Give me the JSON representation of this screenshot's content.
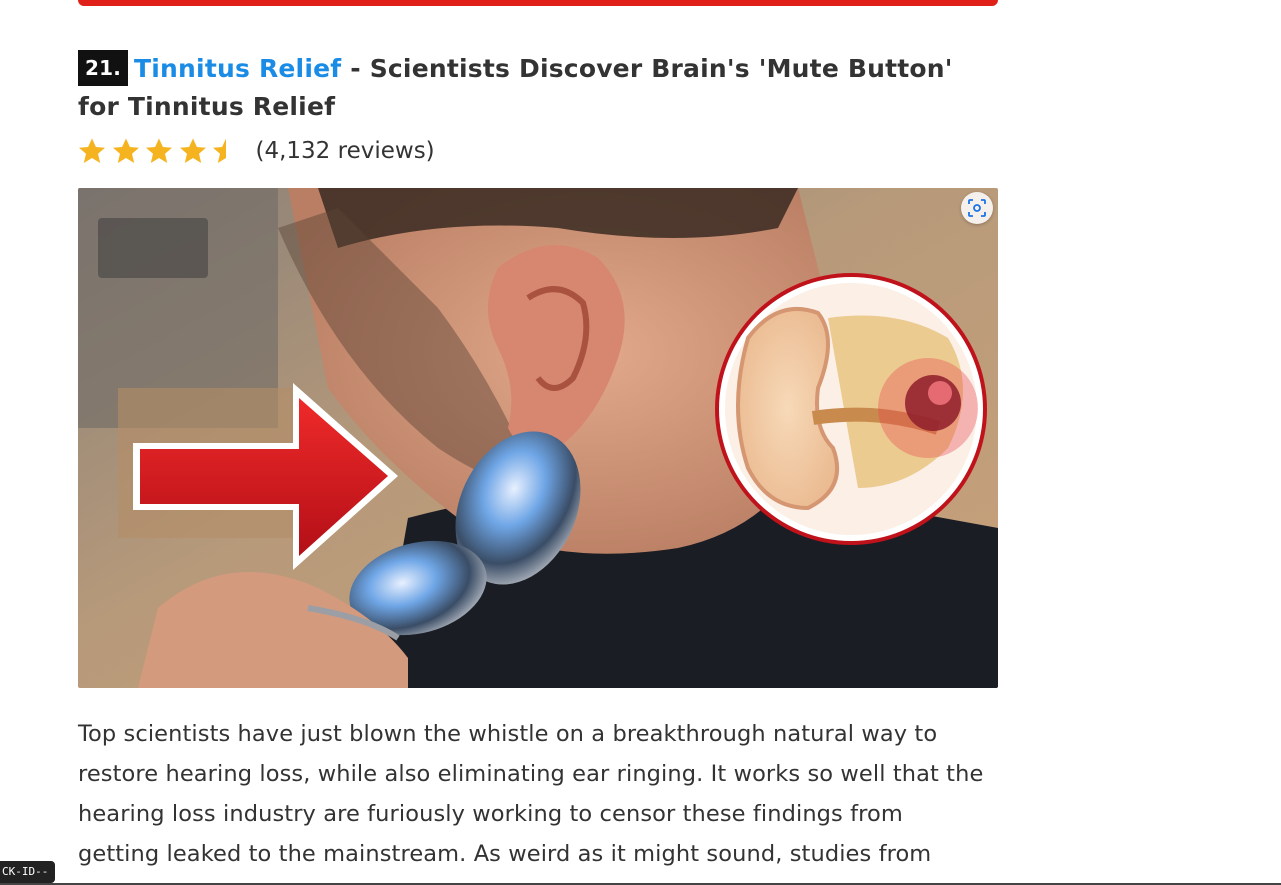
{
  "headline": {
    "number": "21.",
    "link_text": "Tinnitus Relief",
    "rest": " - Scientists Discover Brain's 'Mute Button' for Tinnitus Relief"
  },
  "rating": {
    "value": 4.5,
    "max": 5,
    "reviews_text": "(4,132 reviews)",
    "star_color": "#f5b41f"
  },
  "hero_image": {
    "lens_icon": "visual-search-icon"
  },
  "body": {
    "paragraph": "Top scientists have just blown the whistle on a breakthrough natural way to restore hearing loss, while also eliminating ear ringing. It works so well that the hearing loss industry are furiously working to censor these findings from getting leaked to the mainstream. As weird as it might sound, studies from"
  },
  "debug_tag": "CK-ID--",
  "colors": {
    "accent_red": "#e0211a",
    "link_blue": "#1a8ce6",
    "text": "#333333"
  }
}
